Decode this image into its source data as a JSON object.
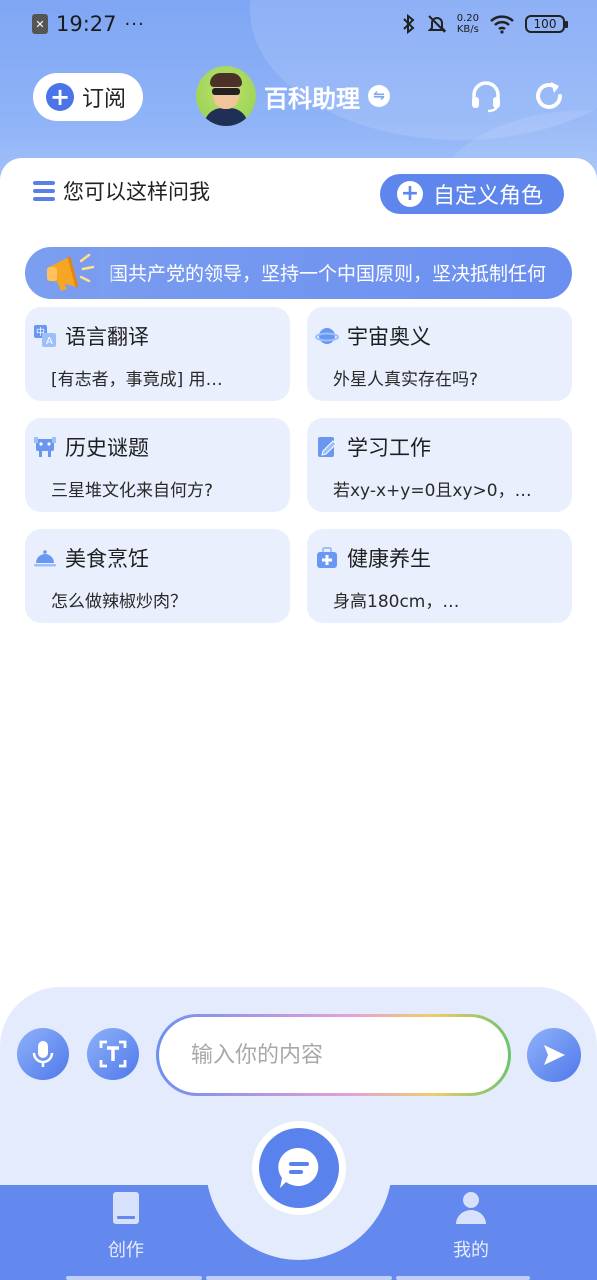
{
  "status_bar": {
    "time": "19:27",
    "dots": "···",
    "app_icon": "x-app-icon",
    "net_speed_value": "0.20",
    "net_speed_unit": "KB/s",
    "battery": "100"
  },
  "header": {
    "subscribe_label": "订阅",
    "assistant_name": "百科助理",
    "switch_icon": "⇋"
  },
  "prompt": {
    "hint": "您可以这样问我",
    "custom_role_label": "自定义角色"
  },
  "notice": {
    "text": "国共产党的领导，坚持一个中国原则，坚决抵制任何"
  },
  "cards": [
    {
      "title": "语言翻译",
      "subtitle": "[有志者，事竟成] 用…",
      "icon": "translate-icon",
      "color": "#5b8ff0"
    },
    {
      "title": "宇宙奥义",
      "subtitle": "外星人真实存在吗?",
      "icon": "planet-icon",
      "color": "#5b8ff0"
    },
    {
      "title": "历史谜题",
      "subtitle": "三星堆文化来自何方?",
      "icon": "artifact-icon",
      "color": "#5b8ff0"
    },
    {
      "title": "学习工作",
      "subtitle": "若xy-x+y=0且xy>0，…",
      "icon": "notebook-icon",
      "color": "#5b8ff0"
    },
    {
      "title": "美食烹饪",
      "subtitle": "怎么做辣椒炒肉？",
      "icon": "food-cover-icon",
      "color": "#5b8ff0"
    },
    {
      "title": "健康养生",
      "subtitle": "身高180cm，…",
      "icon": "medkit-icon",
      "color": "#5b8ff0"
    }
  ],
  "input": {
    "placeholder": "输入你的内容"
  },
  "nav": {
    "left_label": "创作",
    "right_label": "我的"
  },
  "colors": {
    "accent": "#5a82ec",
    "card_bg": "#e9effd",
    "input_area_bg": "#e3ebfc",
    "nav_bg": "#6388ee"
  }
}
